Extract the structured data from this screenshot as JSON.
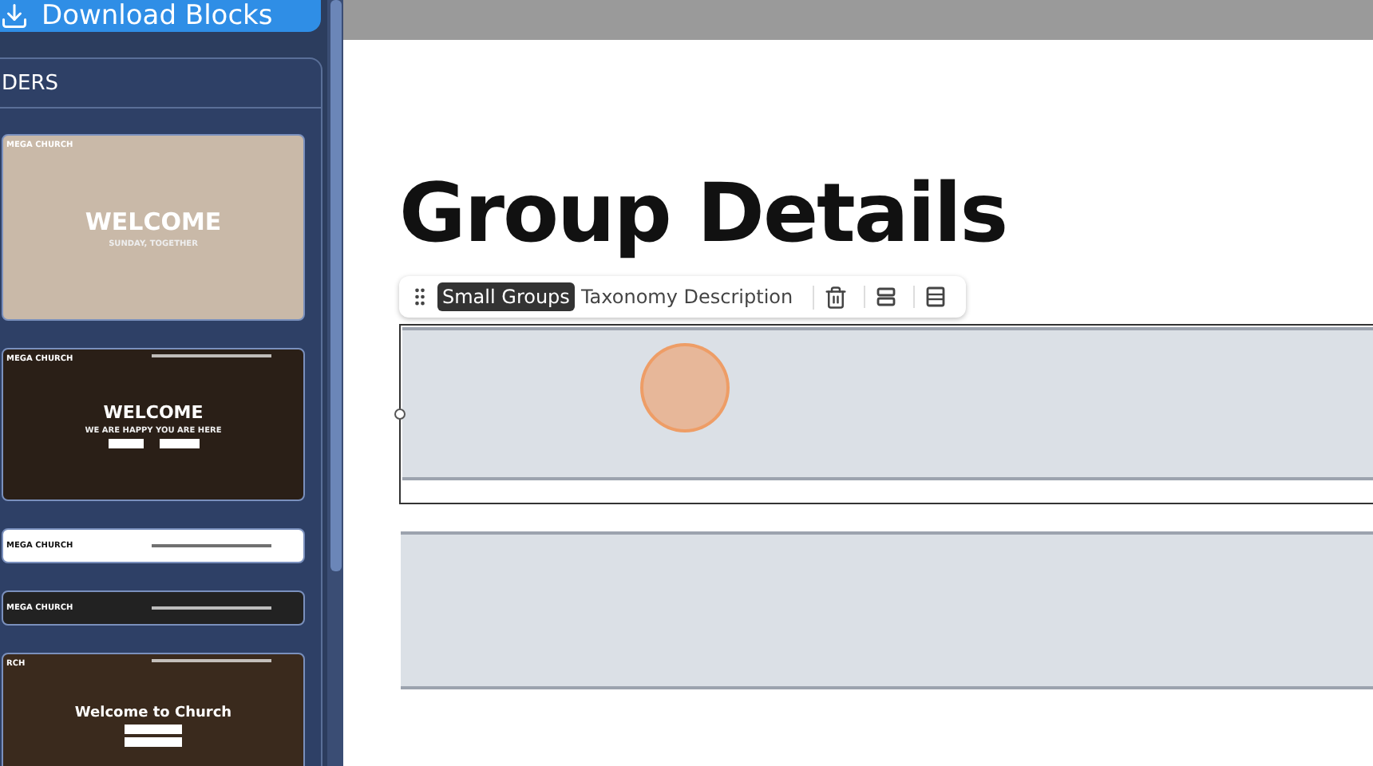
{
  "sidebar": {
    "download_button": "Download Blocks",
    "section_title": "DERS",
    "thumbnails": [
      {
        "kind": "hero-light",
        "logo": "MEGA CHURCH",
        "heading": "WELCOME",
        "subheading": "SUNDAY, TOGETHER"
      },
      {
        "kind": "hero-dark",
        "logo": "MEGA CHURCH",
        "heading": "WELCOME",
        "subheading": "WE ARE HAPPY YOU ARE HERE"
      },
      {
        "kind": "nav-light",
        "logo": "MEGA CHURCH"
      },
      {
        "kind": "nav-dark",
        "logo": "MEGA CHURCH"
      },
      {
        "kind": "hero-dark-center",
        "logo": "RCH",
        "heading": "Welcome to Church"
      }
    ]
  },
  "canvas": {
    "heading": "Group Details",
    "toolbar": {
      "tag": "Small Groups",
      "label": "Taxonomy Description"
    },
    "blocks": [
      {
        "selected": true
      },
      {
        "selected": false
      }
    ]
  }
}
